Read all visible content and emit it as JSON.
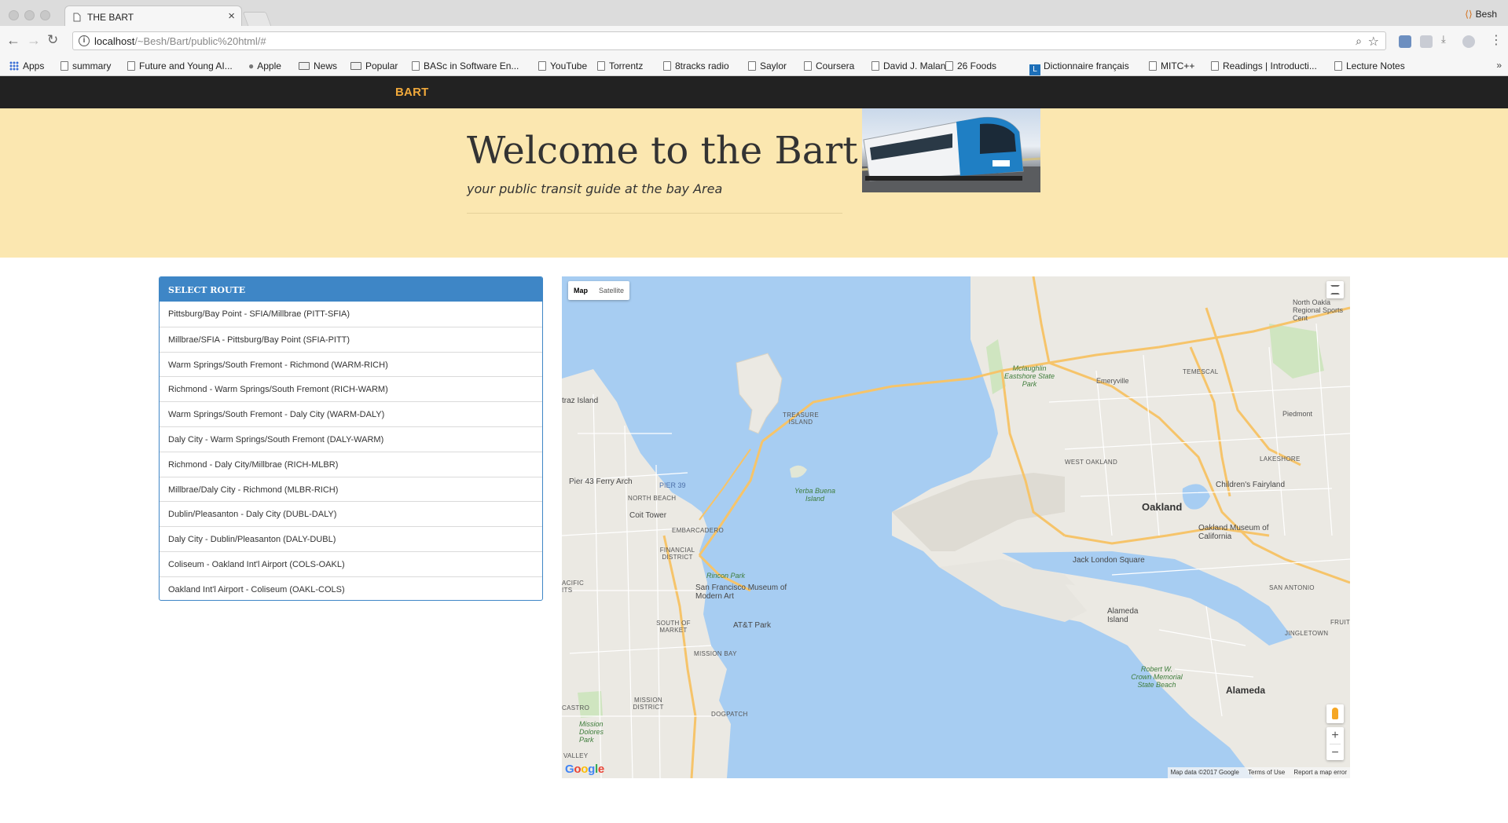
{
  "browser": {
    "tab_title": "THE BART",
    "profile_name": "Besh",
    "url_host": "localhost",
    "url_path": "/~Besh/Bart/public%20html/#",
    "bookmarks": [
      {
        "label": "Apps",
        "icon": "apps-grid-icon"
      },
      {
        "label": "summary",
        "icon": "page-icon"
      },
      {
        "label": "Future and Young AI...",
        "icon": "site-icon"
      },
      {
        "label": "Apple",
        "icon": "apple-icon"
      },
      {
        "label": "News",
        "icon": "folder-icon"
      },
      {
        "label": "Popular",
        "icon": "folder-icon"
      },
      {
        "label": "BASc in Software En...",
        "icon": "site-icon"
      },
      {
        "label": "YouTube",
        "icon": "page-icon"
      },
      {
        "label": "Torrentz",
        "icon": "page-icon"
      },
      {
        "label": "8tracks radio",
        "icon": "page-icon"
      },
      {
        "label": "Saylor",
        "icon": "page-icon"
      },
      {
        "label": "Coursera",
        "icon": "site-icon"
      },
      {
        "label": "David J. Malan",
        "icon": "page-icon"
      },
      {
        "label": "26 Foods",
        "icon": "page-icon"
      },
      {
        "label": "Dictionnaire français",
        "icon": "L-icon"
      },
      {
        "label": "MITC++",
        "icon": "page-icon"
      },
      {
        "label": "Readings | Introducti...",
        "icon": "site-icon"
      },
      {
        "label": "Lecture Notes",
        "icon": "page-icon"
      }
    ],
    "more_bookmarks": "»"
  },
  "navbar": {
    "brand": "BART",
    "brand_color": "#f0a93b"
  },
  "hero": {
    "title": "Welcome to the Bart",
    "subtitle": "your public transit guide at the bay Area",
    "background": "#fbe7b0"
  },
  "routes": {
    "header": "Select Route",
    "accent": "#3e86c6",
    "items": [
      "Pittsburg/Bay Point - SFIA/Millbrae (PITT-SFIA)",
      "Millbrae/SFIA - Pittsburg/Bay Point (SFIA-PITT)",
      "Warm Springs/South Fremont - Richmond (WARM-RICH)",
      "Richmond - Warm Springs/South Fremont (RICH-WARM)",
      "Warm Springs/South Fremont - Daly City (WARM-DALY)",
      "Daly City - Warm Springs/South Fremont (DALY-WARM)",
      "Richmond - Daly City/Millbrae (RICH-MLBR)",
      "Millbrae/Daly City - Richmond (MLBR-RICH)",
      "Dublin/Pleasanton - Daly City (DUBL-DALY)",
      "Daly City - Dublin/Pleasanton (DALY-DUBL)",
      "Coliseum - Oakland Int'l Airport (COLS-OAKL)",
      "Oakland Int'l Airport - Coliseum (OAKL-COLS)"
    ]
  },
  "map": {
    "type_map": "Map",
    "type_satellite": "Satellite",
    "zoom_in": "+",
    "zoom_out": "−",
    "logo": "Google",
    "attribution": "Map data ©2017 Google",
    "terms": "Terms of Use",
    "report": "Report a map error",
    "labels": {
      "oakland": "Oakland",
      "alameda": "Alameda",
      "emeryville": "Emeryville",
      "piedmont": "Piedmont",
      "temescal": "TEMESCAL",
      "west_oakland": "WEST OAKLAND",
      "lakeshore": "LAKESHORE",
      "san_antonio": "SAN ANTONIO",
      "jingletown": "JINGLETOWN",
      "fruit": "FRUIT",
      "treasure_island": "TREASURE ISLAND",
      "yerba_buena": "Yerba Buena Island",
      "alcatraz": "traz Island",
      "pier43": "Pier 43 Ferry Arch",
      "pier39": "PIER 39",
      "north_beach": "NORTH BEACH",
      "coit": "Coit Tower",
      "embarcadero": "EMBARCADERO",
      "financial": "FINANCIAL DISTRICT",
      "rincon": "Rincon Park",
      "sfmoma": "San Francisco Museum of Modern Art",
      "att_park": "AT&T Park",
      "south_market": "SOUTH OF MARKET",
      "mission_bay": "MISSION BAY",
      "mission_district": "MISSION DISTRICT",
      "dogpatch": "DOGPATCH",
      "mission_dolores": "Mission Dolores Park",
      "valley": "VALLEY",
      "castro": "CASTRO",
      "pacific": "ACIFIC ITS",
      "mclaughlin": "Mclaughlin Eastshore State Park",
      "childrens": "Children's Fairyland",
      "oakland_museum": "Oakland Museum of California",
      "jack_london": "Jack London Square",
      "alameda_island": "Alameda Island",
      "crown": "Robert W. Crown Memorial State Beach",
      "north_oakland": "North Oakla Regional Sports Cent"
    }
  }
}
